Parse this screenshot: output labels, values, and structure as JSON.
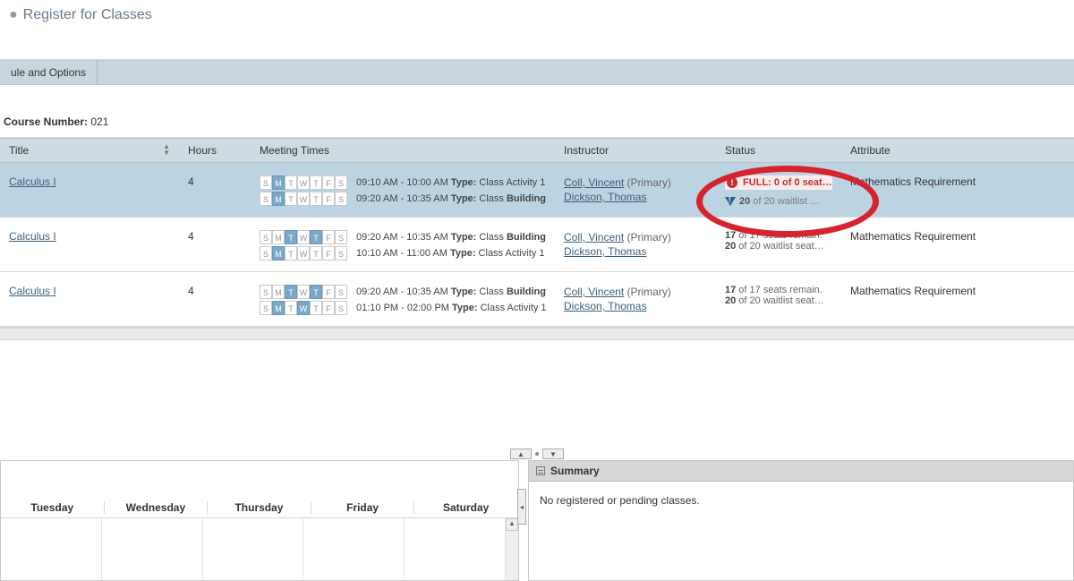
{
  "page_title": "Register for Classes",
  "tab_label": "ule and Options",
  "course_number_label": "Course Number:",
  "course_number_value": "021",
  "columns": {
    "title": "Title",
    "hours": "Hours",
    "meeting": "Meeting Times",
    "instructor": "Instructor",
    "status": "Status",
    "attribute": "Attribute"
  },
  "rows": [
    {
      "title": "Calculus I",
      "hours": "4",
      "meetings": [
        {
          "days": [
            0,
            1,
            0,
            0,
            0,
            0,
            0
          ],
          "time": "09:10 AM - 10:00 AM",
          "type": "Class Activity 1",
          "suffix": ""
        },
        {
          "days": [
            0,
            1,
            0,
            0,
            0,
            0,
            0
          ],
          "time": "09:20 AM - 10:35 AM",
          "type": "Class",
          "suffix": "Building:"
        }
      ],
      "instructors": [
        {
          "name": "Coll, Vincent",
          "suffix": " (Primary)"
        },
        {
          "name": "Dickson, Thomas",
          "suffix": ""
        }
      ],
      "status_full": "FULL: 0 of 0 seat…",
      "status_wait_prefix": "20",
      "status_wait_rest": " of 20 waitlist …",
      "attribute": "Mathematics Requirement",
      "highlight": true
    },
    {
      "title": "Calculus I",
      "hours": "4",
      "meetings": [
        {
          "days": [
            0,
            0,
            1,
            0,
            1,
            0,
            0
          ],
          "time": "09:20 AM - 10:35 AM",
          "type": "Class",
          "suffix": "Building:"
        },
        {
          "days": [
            0,
            1,
            0,
            0,
            0,
            0,
            0
          ],
          "time": "10:10 AM - 11:00 AM",
          "type": "Class Activity 1",
          "suffix": ""
        }
      ],
      "instructors": [
        {
          "name": "Coll, Vincent",
          "suffix": " (Primary)"
        },
        {
          "name": "Dickson, Thomas",
          "suffix": ""
        }
      ],
      "status_line1_b": "17",
      "status_line1_rest": " of 17 seats remain.",
      "status_line2_b": "20",
      "status_line2_rest": " of 20 waitlist seat…",
      "attribute": "Mathematics Requirement",
      "highlight": false
    },
    {
      "title": "Calculus I",
      "hours": "4",
      "meetings": [
        {
          "days": [
            0,
            0,
            1,
            0,
            1,
            0,
            0
          ],
          "time": "09:20 AM - 10:35 AM",
          "type": "Class",
          "suffix": "Building:"
        },
        {
          "days": [
            0,
            1,
            0,
            1,
            0,
            0,
            0
          ],
          "time": "01:10 PM - 02:00 PM",
          "type": "Class Activity 1",
          "suffix": ""
        }
      ],
      "instructors": [
        {
          "name": "Coll, Vincent",
          "suffix": " (Primary)"
        },
        {
          "name": "Dickson, Thomas",
          "suffix": ""
        }
      ],
      "status_line1_b": "17",
      "status_line1_rest": " of 17 seats remain.",
      "status_line2_b": "20",
      "status_line2_rest": " of 20 waitlist seat…",
      "attribute": "Mathematics Requirement",
      "highlight": false
    }
  ],
  "day_letters": [
    "S",
    "M",
    "T",
    "W",
    "T",
    "F",
    "S"
  ],
  "type_label": "Type:",
  "summary_title": "Summary",
  "summary_empty": "No registered or pending classes.",
  "calendar_days": [
    "Tuesday",
    "Wednesday",
    "Thursday",
    "Friday",
    "Saturday"
  ]
}
